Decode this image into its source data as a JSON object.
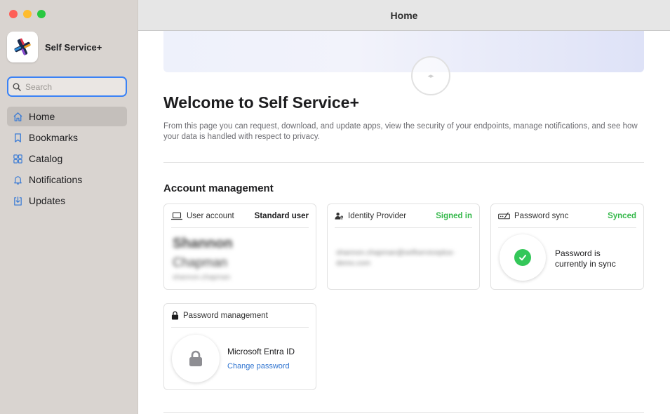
{
  "window": {
    "title": "Home",
    "colors": {
      "close": "#fe5f57",
      "minimize": "#febc2e",
      "zoom": "#28c840"
    }
  },
  "sidebar": {
    "app_name": "Self Service+",
    "search_placeholder": "Search",
    "items": [
      {
        "label": "Home",
        "icon": "house-icon",
        "active": true
      },
      {
        "label": "Bookmarks",
        "icon": "bookmark-icon",
        "active": false
      },
      {
        "label": "Catalog",
        "icon": "grid-icon",
        "active": false
      },
      {
        "label": "Notifications",
        "icon": "bell-icon",
        "active": false
      },
      {
        "label": "Updates",
        "icon": "download-tray-icon",
        "active": false
      }
    ]
  },
  "main": {
    "welcome_title": "Welcome to Self Service+",
    "intro": "From this page you can request, download, and update apps, view the security of your endpoints, manage notifications, and see how your data is handled with respect to privacy.",
    "account_section_title": "Account management",
    "cards": {
      "user_account": {
        "label": "User account",
        "status": "Standard user",
        "name_line1": "Shannon",
        "name_line2": "Chapman",
        "sub": "shannon.chapman"
      },
      "identity_provider": {
        "label": "Identity Provider",
        "status": "Signed in",
        "value": "shannon.chapman@selfserviceplus-demo.com"
      },
      "password_sync": {
        "label": "Password sync",
        "status": "Synced",
        "message": "Password is currently in sync"
      },
      "password_management": {
        "label": "Password management",
        "provider": "Microsoft Entra ID",
        "link": "Change password"
      }
    },
    "colors": {
      "accent": "#3a82f6",
      "success": "#34b84a",
      "link": "#2f74d0"
    }
  }
}
